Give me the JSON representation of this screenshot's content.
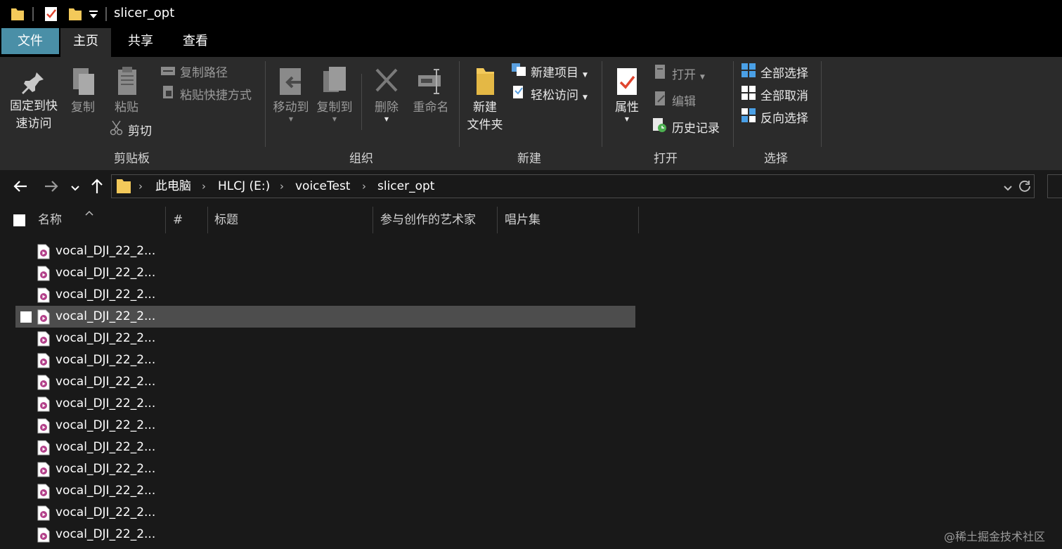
{
  "title_bar": {
    "title": "slicer_opt"
  },
  "ribbon_tabs": [
    {
      "label": "文件"
    },
    {
      "label": "主页"
    },
    {
      "label": "共享"
    },
    {
      "label": "查看"
    }
  ],
  "ribbon": {
    "clipboard": {
      "pin_label_line1": "固定到快",
      "pin_label_line2": "速访问",
      "copy_label": "复制",
      "paste_label": "粘贴",
      "copy_path_label": "复制路径",
      "paste_shortcut_label": "粘贴快捷方式",
      "cut_label": "剪切",
      "group_label": "剪贴板"
    },
    "organize": {
      "move_to_label": "移动到",
      "copy_to_label": "复制到",
      "delete_label": "删除",
      "rename_label": "重命名",
      "group_label": "组织"
    },
    "new": {
      "new_folder_line1": "新建",
      "new_folder_line2": "文件夹",
      "new_item_label": "新建项目",
      "easy_access_label": "轻松访问",
      "group_label": "新建"
    },
    "open": {
      "properties_label": "属性",
      "open_label": "打开",
      "edit_label": "编辑",
      "history_label": "历史记录",
      "group_label": "打开"
    },
    "select": {
      "select_all_label": "全部选择",
      "select_none_label": "全部取消",
      "invert_label": "反向选择",
      "group_label": "选择"
    }
  },
  "address_bar": {
    "breadcrumbs": [
      "此电脑",
      "HLCJ (E:)",
      "voiceTest",
      "slicer_opt"
    ]
  },
  "columns": {
    "name": "名称",
    "number": "#",
    "title": "标题",
    "artist": "参与创作的艺术家",
    "album": "唱片集"
  },
  "files": [
    {
      "name": "vocal_DJI_22_2..."
    },
    {
      "name": "vocal_DJI_22_2..."
    },
    {
      "name": "vocal_DJI_22_2..."
    },
    {
      "name": "vocal_DJI_22_2...",
      "selected": true
    },
    {
      "name": "vocal_DJI_22_2..."
    },
    {
      "name": "vocal_DJI_22_2..."
    },
    {
      "name": "vocal_DJI_22_2..."
    },
    {
      "name": "vocal_DJI_22_2..."
    },
    {
      "name": "vocal_DJI_22_2..."
    },
    {
      "name": "vocal_DJI_22_2..."
    },
    {
      "name": "vocal_DJI_22_2..."
    },
    {
      "name": "vocal_DJI_22_2..."
    },
    {
      "name": "vocal_DJI_22_2..."
    },
    {
      "name": "vocal_DJI_22_2..."
    }
  ],
  "watermark": "@稀土掘金技术社区",
  "colors": {
    "background": "#191919",
    "ribbon": "#2b2b2b",
    "file_tab": "#4a8fa7",
    "selected_row": "#4d4d4d",
    "folder": "#f3c95a",
    "audio_icon": "#b3418a"
  }
}
